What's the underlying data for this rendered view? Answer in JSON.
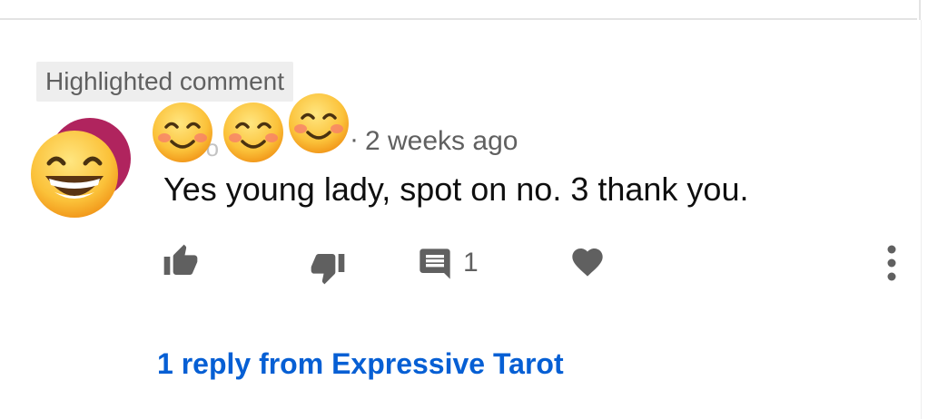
{
  "badge": {
    "label": "Highlighted comment"
  },
  "comment": {
    "author_fragment": "n    o",
    "separator": "·",
    "timestamp": "2 weeks ago",
    "text": "Yes young lady, spot on no. 3 thank you."
  },
  "actions": {
    "reply_count": "1"
  },
  "replies": {
    "link_text": "1 reply from Expressive Tarot"
  },
  "icons": {
    "avatar": "grinning-face-emoji",
    "author_name": "smiling-face-emoji",
    "like": "thumbs-up-icon",
    "dislike": "thumbs-down-icon",
    "reply": "comment-icon",
    "heart": "heart-icon",
    "more": "more-vertical-icon"
  },
  "colors": {
    "link": "#065fd4",
    "secondary_text": "#606060",
    "primary_text": "#0f0f0f",
    "icon": "#606060",
    "avatar_ring": "#b0245e"
  }
}
